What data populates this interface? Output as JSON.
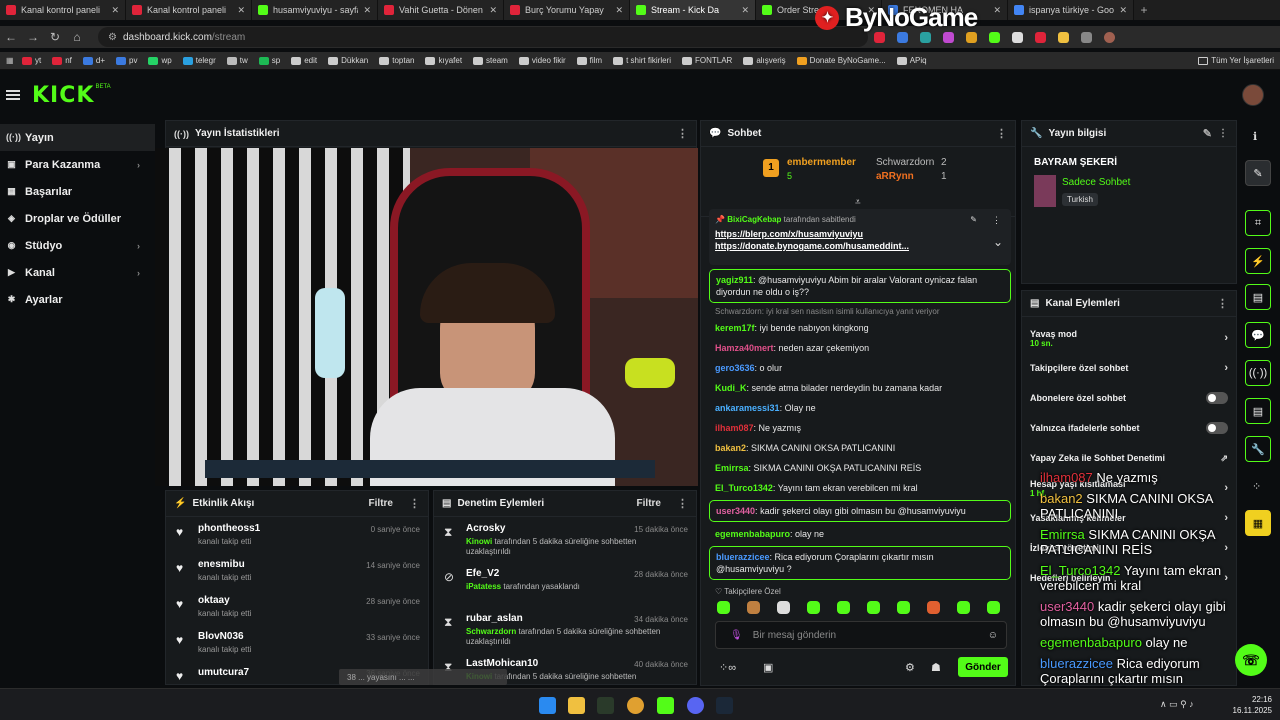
{
  "browser": {
    "tabs": [
      {
        "title": "Kanal kontrol paneli",
        "color": "#e0243a"
      },
      {
        "title": "Kanal kontrol paneli",
        "color": "#e0243a"
      },
      {
        "title": "husamviyuviyu - sayfa",
        "color": "#53fc18"
      },
      {
        "title": "Vahit Guetta - Dönen",
        "color": "#e0243a"
      },
      {
        "title": "Burç Yorumu Yapay",
        "color": "#e0243a"
      },
      {
        "title": "Stream - Kick Da",
        "color": "#53fc18"
      },
      {
        "title": "Order Stream",
        "color": "#53fc18"
      },
      {
        "title": "FENOMEN HA",
        "color": "#3b7ae0"
      },
      {
        "title": "ispanya türkiye - Goo",
        "color": "#4285f4"
      }
    ],
    "url_domain": "dashboard.kick.com",
    "url_path": "/stream",
    "bookmarks": [
      "yt",
      "nf",
      "d+",
      "pv",
      "wp",
      "telegr",
      "tw",
      "sp",
      "edit",
      "Dükkan",
      "toptan",
      "kıyafet",
      "steam",
      "video fikir",
      "film",
      "t shirt fikirleri",
      "FONTLAR",
      "alışveriş",
      "Donate ByNoGame...",
      "APiq"
    ],
    "bookmarks_right": "Tüm Yer İşaretleri",
    "watermark": "ByNoGame"
  },
  "kick": {
    "logo": "KICK",
    "beta": "BETA"
  },
  "sidebar": {
    "items": [
      {
        "label": "Yayın",
        "icon": "broadcast-icon",
        "glyph": "((·))",
        "chevron": ""
      },
      {
        "label": "Para Kazanma",
        "icon": "wallet-icon",
        "glyph": "▣",
        "chevron": "›"
      },
      {
        "label": "Başarılar",
        "icon": "trophy-icon",
        "glyph": "▦",
        "chevron": ""
      },
      {
        "label": "Droplar ve Ödüller",
        "icon": "gift-icon",
        "glyph": "◈",
        "chevron": ""
      },
      {
        "label": "Stüdyo",
        "icon": "studio-icon",
        "glyph": "◉",
        "chevron": "›"
      },
      {
        "label": "Kanal",
        "icon": "channel-icon",
        "glyph": "▶",
        "chevron": "›"
      },
      {
        "label": "Ayarlar",
        "icon": "settings-icon",
        "glyph": "✱",
        "chevron": ""
      }
    ]
  },
  "stats": {
    "title": "Yayın İstatistikleri"
  },
  "activity": {
    "title": "Etkinlik Akışı",
    "filter": "Filtre",
    "items": [
      {
        "name": "phontheoss1",
        "desc": "kanalı takip etti",
        "time": "0 saniye önce"
      },
      {
        "name": "enesmibu",
        "desc": "kanalı takip etti",
        "time": "14 saniye önce"
      },
      {
        "name": "oktaay",
        "desc": "kanalı takip etti",
        "time": "28 saniye önce"
      },
      {
        "name": "BlovN036",
        "desc": "kanalı takip etti",
        "time": "33 saniye önce"
      },
      {
        "name": "umutcura7",
        "desc": "",
        "time": "36 saniye önce"
      }
    ]
  },
  "moderation": {
    "title": "Denetim Eylemleri",
    "filter": "Filtre",
    "items": [
      {
        "name": "Acrosky",
        "mod": "Kinowi",
        "desc": "tarafından 5 dakika süreliğine sohbetten uzaklaştırıldı",
        "time": "15 dakika önce",
        "icon": "⧗"
      },
      {
        "name": "Efe_V2",
        "mod": "iPatatess",
        "desc": "tarafından yasaklandı",
        "time": "28 dakika önce",
        "icon": "⊘"
      },
      {
        "name": "rubar_aslan",
        "mod": "Schwarzdorn",
        "desc": "tarafından 5 dakika süreliğine sohbetten uzaklaştırıldı",
        "time": "34 dakika önce",
        "icon": "⧗"
      },
      {
        "name": "LastMohican10",
        "mod": "Kinowi",
        "desc": "tarafından 5 dakika süreliğine sohbetten",
        "time": "40 dakika önce",
        "icon": "⧗"
      }
    ]
  },
  "toast": "38 ... yayasını ... ...",
  "chat": {
    "title": "Sohbet",
    "leaderboard": [
      {
        "rank": "1",
        "name": "embermember",
        "count": "5"
      },
      {
        "rank": "",
        "name": "Schwarzdorn",
        "count": "2"
      },
      {
        "rank": "",
        "name": "aRRynn",
        "count": "1"
      }
    ],
    "pinned": {
      "by": "BixiCagKebap",
      "label": "tarafından sabitlendi",
      "link1": "https://blerp.com/x/husamviyuviyu",
      "link2": "https://donate.bynogame.com/husameddint..."
    },
    "messages": [
      {
        "user": "yagiz911",
        "color": "#53fc18",
        "text": "@husamviyuviyu Abim bir aralar Valorant oynicaz falan diyordun ne oldu o iş??",
        "hl": true
      },
      {
        "user": "kerem17f",
        "color": "#53fc18",
        "text": "iyi bende nabıyon kingkong",
        "hl": false,
        "reply": "Schwarzdorn: iyi kral sen nasılsın isimli kullanıcıya yanıt veriyor"
      },
      {
        "user": "Hamza40mert",
        "color": "#e0508a",
        "text": "neden azar çekemiyon",
        "hl": false
      },
      {
        "user": "gero3636",
        "color": "#4a9aff",
        "text": "o olur",
        "hl": false
      },
      {
        "user": "Kudi_K",
        "color": "#53fc18",
        "text": "sende atma bilader nerdeydin bu zamana kadar",
        "hl": false
      },
      {
        "user": "ankaramessi31",
        "color": "#4ab0ff",
        "text": "Olay ne",
        "hl": false
      },
      {
        "user": "ilham087",
        "color": "#e0303a",
        "text": "Ne yazmış",
        "hl": false
      },
      {
        "user": "bakan2",
        "color": "#f0c040",
        "text": "SIKMA CANINI OKSA PATLICANINI",
        "hl": false
      },
      {
        "user": "Emirrsa",
        "color": "#53fc18",
        "text": "SIKMA CANINI OKŞA PATLICANINI REİS",
        "hl": false
      },
      {
        "user": "El_Turco1342",
        "color": "#53fc18",
        "text": "Yayını tam ekran verebilcen mi kral",
        "hl": false
      },
      {
        "user": "user3440",
        "color": "#e060a0",
        "text": "kadir şekerci olayı gibi olmasın bu @husamviyuviyu",
        "hl": true
      },
      {
        "user": "egemenbabapuro",
        "color": "#53fc18",
        "text": "olay ne",
        "hl": false
      },
      {
        "user": "bluerazzicee",
        "color": "#4a9aff",
        "text": "Rica ediyorum Çoraplarını çıkartır mısın @husamviyuviyu ?",
        "hl": true
      }
    ],
    "follower_only": "Takipçilere Özel",
    "input_placeholder": "Bir mesaj gönderin",
    "send": "Gönder"
  },
  "info": {
    "title": "Yayın bilgisi",
    "stream_title": "BAYRAM ŞEKERİ",
    "category": "Sadece Sohbet",
    "language": "Turkish"
  },
  "actions": {
    "title": "Kanal Eylemleri",
    "items": [
      {
        "label": "Yavaş mod",
        "sub": "10 sn.",
        "control": "chevron"
      },
      {
        "label": "Takipçilere özel sohbet",
        "sub": "",
        "control": "chevron"
      },
      {
        "label": "Abonelere özel sohbet",
        "sub": "",
        "control": "toggle"
      },
      {
        "label": "Yalnızca ifadelerle sohbet",
        "sub": "",
        "control": "toggle"
      },
      {
        "label": "Yapay Zeka ile Sohbet Denetimi",
        "sub": "",
        "control": "external"
      },
      {
        "label": "Hesap yaşı kısıtlaması",
        "sub": "1 hf.",
        "control": "chevron"
      },
      {
        "label": "Yasaklanmış kelimeler",
        "sub": "",
        "control": "chevron"
      },
      {
        "label": "İzleyici yönetimi",
        "sub": "",
        "control": "chevron"
      },
      {
        "label": "Hedefleri belirleyin",
        "sub": "",
        "control": "chevron"
      }
    ]
  },
  "overlay_chat": [
    {
      "user": "ilham087",
      "color": "#e0303a",
      "text": "Ne yazmış"
    },
    {
      "user": "bakan2",
      "color": "#f0c040",
      "text": "SIKMA CANINI OKSA PATLICANINI"
    },
    {
      "user": "Emirrsa",
      "color": "#53fc18",
      "text": "SIKMA CANINI OKŞA PATLICANINI REİS"
    },
    {
      "user": "El_Turco1342",
      "color": "#53fc18",
      "text": "Yayını tam ekran verebilcen mi kral"
    },
    {
      "user": "user3440",
      "color": "#e060a0",
      "text": "kadir şekerci olayı gibi olmasın bu @husamviyuviyu"
    },
    {
      "user": "egemenbabapuro",
      "color": "#53fc18",
      "text": "olay ne"
    },
    {
      "user": "bluerazzicee",
      "color": "#4a9aff",
      "text": "Rica ediyorum Çoraplarını çıkartır mısın @husamviyuviyu ?"
    }
  ],
  "taskbar": {
    "time": "22:16",
    "date": "16.11.2025"
  },
  "colors": {
    "accent": "#53fc18",
    "panel": "#171a1c",
    "background": "#0b0d0f"
  }
}
